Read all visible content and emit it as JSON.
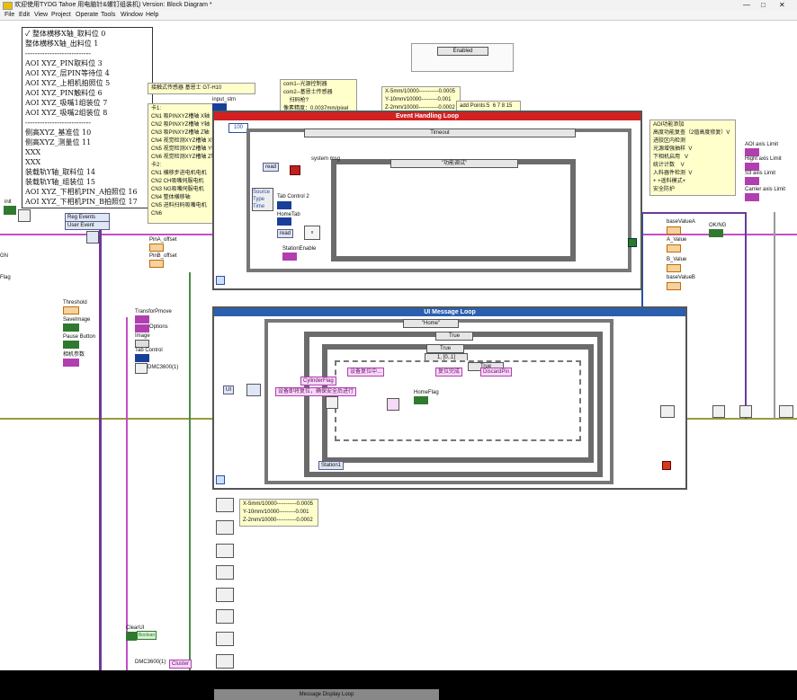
{
  "window": {
    "title": "欢迎使用TYDG Tahoe 用电脑针&螺钉组装机) Version: Block Diagram *",
    "controls": [
      "—",
      "□",
      "✕"
    ]
  },
  "menu": [
    "File",
    "Edit",
    "View",
    "Project",
    "Operate",
    "Tools",
    "Window",
    "Help"
  ],
  "positions_list": [
    "✓ 整体横移X轴_取料位 0",
    "   整体横移X轴_出料位 1",
    "---------------------------",
    "AOI XYZ_PIN取料位  3",
    "AOI XYZ_层PIN等待位 4",
    "AOI XYZ_上相机拍照位  5",
    "AOI XYZ_PIN触料位  6",
    "AOI XYZ_吸嘴1组装位 7",
    "AOI XYZ_吸嘴2组装位 8",
    "---------------------------",
    "侧高XYZ_基准位    10",
    "侧高XYZ_测量位    11",
    "XXX",
    "XXX",
    "装载轨Y轴_取料位    14",
    "装载轨Y轴_组装位    15",
    "AOI XYZ_下相机PIN_A拍照位   16",
    "AOI XYZ_下相机PIN_B拍照位   17"
  ],
  "notes": {
    "sensor": "接触式传感器 基恩士 GT-H10",
    "com": "com1--光源控制器\ncom2--基恩士传感器\n    扫码枪?\n像素精度：0.0037mm/pixel",
    "xyz_top": "X-5mm/10000-----------0.0005\nY-10mm/10000---------0.001\nZ-2mm/10000-----------0.0002",
    "add_points": "add Points:5  6 7 8 15",
    "io": "卡1:\nCN1 吸PINXYZ槽轴 X轴\nCN2 吸PINXYZ槽轴 Y轴\nCN3 吸PINXYZ槽轴 Z轴\nCN4 视觉检测XYZ槽轴 X轴\nCN5 视觉检测XYZ槽轴 Y轴\nCN6 视觉检测XYZ槽轴 Z轴\n卡2:\nCN1 横移步进电机电机\nCN2 CH吸嘴伺服电机\nCN3 NG吸嘴伺服电机\nCN4 整体横移轴\nCN5 进料扫码吸嘴电机\nCN6",
    "aoi": "AOI功能添加\n高度功能复查（2值高度修复）V\n进胶区内检测\n光源增强抽样  V\n下相机启用   V\n统计计数    V\n入料器件检测  V\n+ +遥料模式+\n安全防护",
    "xyz_bottom": "X-5mm/10000-----------0.0005\nY-10mm/10000---------0.001\nZ-2mm/10000-----------0.0002"
  },
  "enabled_selector": "Enabled",
  "event_loop": {
    "title": "Event Handling Loop",
    "case": "Timeout",
    "count": "100",
    "read": "read",
    "sys_msg": "system msg",
    "func_case": "\"功能调试\"",
    "source_items": [
      "Source",
      "Type",
      "Time"
    ],
    "tab2": "Tab Control 2",
    "hometab": "HomeTab",
    "read2": "read",
    "station_enable": "StationEnable",
    "uploc": "上料位置"
  },
  "ui_loop": {
    "title": "UI Message Loop",
    "case_home": "\"Home\"",
    "true1": "True",
    "true2": "True",
    "true3": "True",
    "range": "1, [0..1]",
    "cylinder": "CylinderFlag",
    "msg_reset": "设备即将复位，确保安全后进行",
    "dev_reset": "设备复位中...",
    "reset_done": "复位完成",
    "discard": "DiscardPin",
    "homeflag": "HomeFlag",
    "station": "Station1",
    "ui_tag": "UI"
  },
  "left_panel": {
    "init": "init",
    "gn": "GN",
    "flag": "Flag",
    "reg_events": "Reg Events",
    "user_event": "User Event",
    "pina": "PinA_offset",
    "pinb": "PinB_offset",
    "threshold": "Threshold",
    "saveimage": "SaveImage",
    "pause": "Pause Button",
    "param": "相机参数",
    "transfer": "TransforPmove",
    "options": "Options",
    "image": "Image",
    "tabcontrol": "Tab Control",
    "dmc": "DMC3600(1)",
    "clearui": "ClearUI",
    "boolean": "Boolean",
    "dmc2": "DMC3600(1)",
    "cluster": "Cluster"
  },
  "right_panel": {
    "base_a": "baseValueA",
    "a_value": "A_Value",
    "b_value": "B_Value",
    "base_b": "baseValueB",
    "ok_ng": "OK/NG",
    "aoi_limit": "AOI axis Limit",
    "hight_limit": "Hight axis Limit",
    "s3_limit": "S3 axis Limit",
    "carrier_limit": "Carrier axis Limit",
    "input_label": "input_stm"
  },
  "bottom_header": "Message Display Loop",
  "colors": {
    "event_header": "#d42020",
    "ui_header": "#2a5fb0",
    "pink": "#c54ec5",
    "purple": "#6a3a9a",
    "note_bg": "#ffffcc"
  }
}
